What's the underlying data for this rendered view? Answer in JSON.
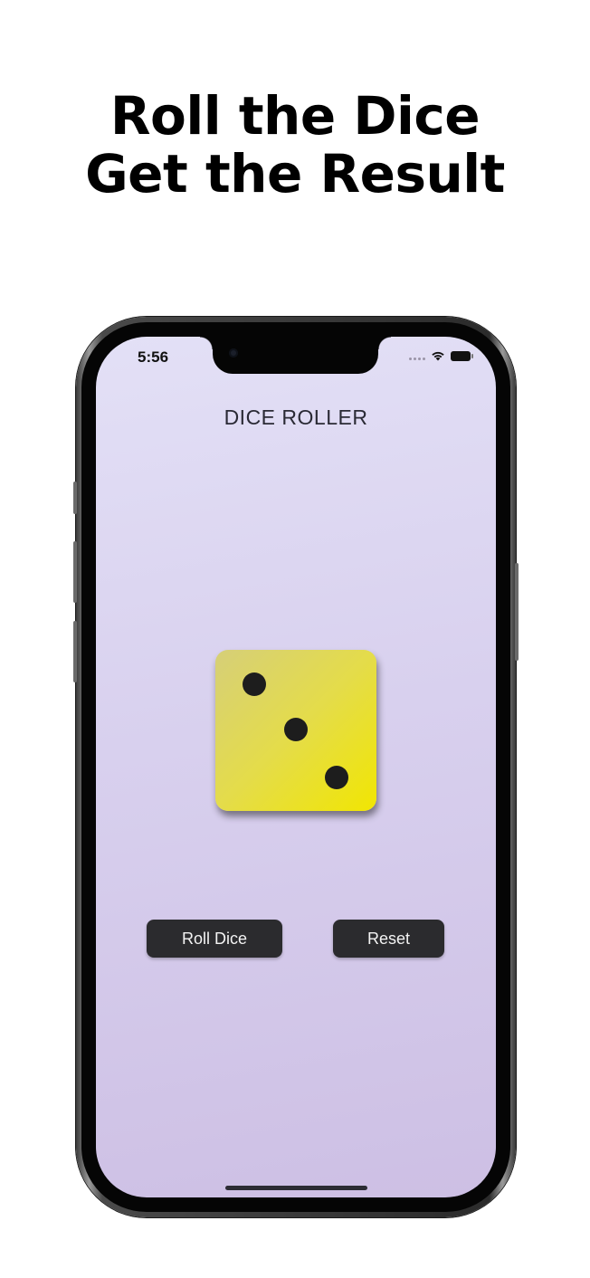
{
  "headline": {
    "line1": "Roll the Dice",
    "line2": "Get the Result"
  },
  "status_bar": {
    "time": "5:56",
    "icons": [
      "signal-dots-icon",
      "wifi-icon",
      "battery-icon"
    ]
  },
  "app": {
    "title": "DICE ROLLER",
    "die": {
      "face_value": 3,
      "color": "#e8e024",
      "pip_color": "#1d1d1d"
    },
    "buttons": {
      "roll_label": "Roll Dice",
      "reset_label": "Reset"
    }
  },
  "colors": {
    "background_gradient_top": "#e3e0f6",
    "background_gradient_bottom": "#cdbfe4",
    "button": "#2b2b2e"
  }
}
